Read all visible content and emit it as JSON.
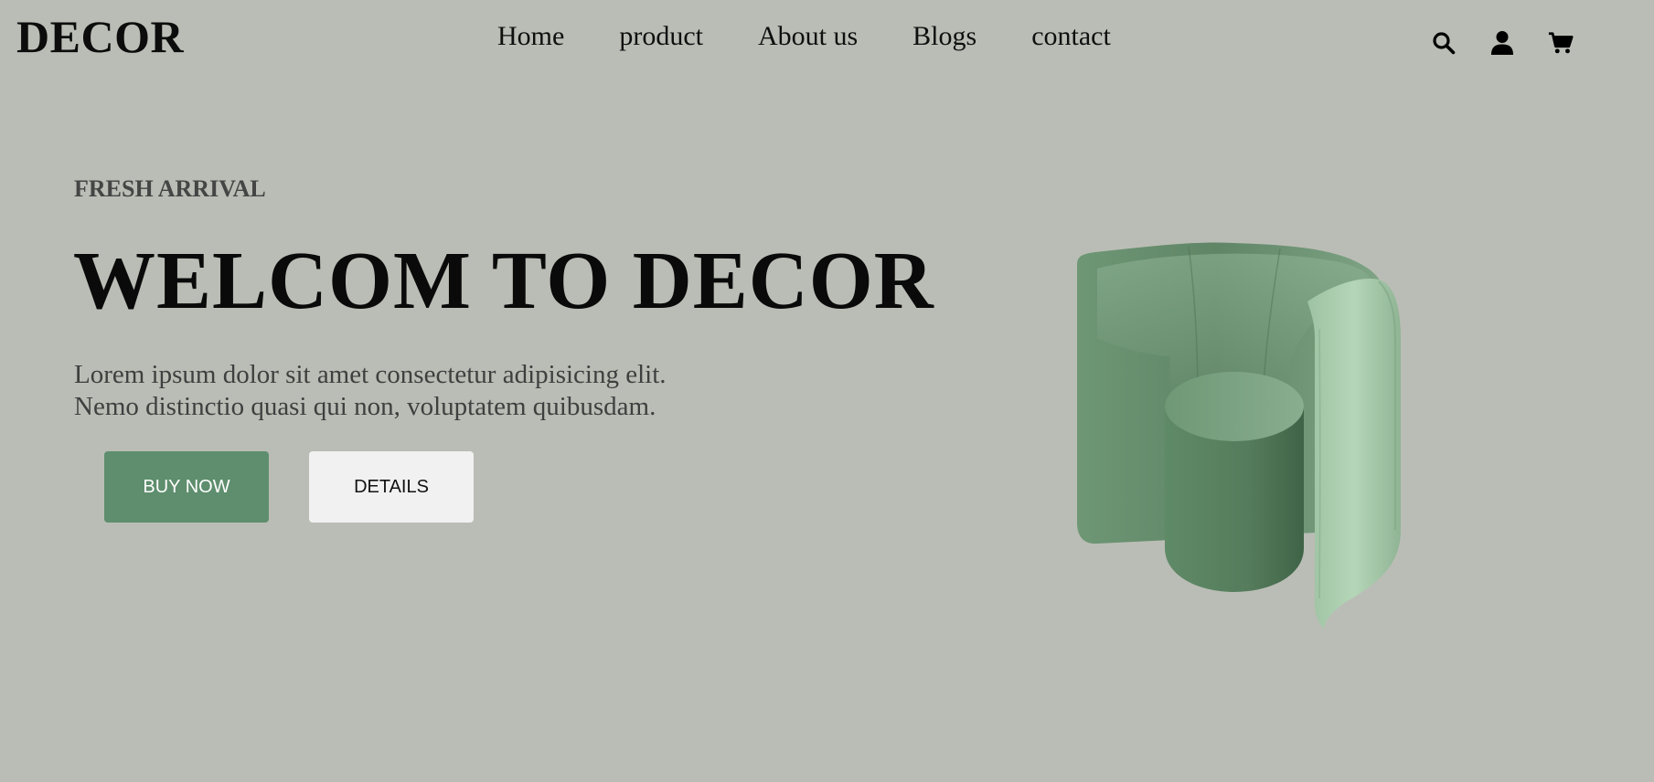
{
  "brand": {
    "logo": "DECOR"
  },
  "nav": {
    "items": [
      {
        "label": "Home"
      },
      {
        "label": "product"
      },
      {
        "label": "About us"
      },
      {
        "label": "Blogs"
      },
      {
        "label": "contact"
      }
    ]
  },
  "header_icons": [
    "search-icon",
    "user-icon",
    "cart-icon"
  ],
  "hero": {
    "eyebrow": "FRESH ARRIVAL",
    "title": "WELCOM TO DECOR",
    "description_lines": [
      "Lorem ipsum dolor sit amet consectetur adipisicing elit.",
      "Nemo distinctio quasi qui non, voluptatem quibusdam."
    ],
    "buy_label": "BUY NOW",
    "details_label": "DETAILS",
    "image": "green-armchair"
  },
  "colors": {
    "background": "#babdb5",
    "buy_button": "#5e8e6d",
    "details_button": "#f1f1f1",
    "chair_green": "#6f9a78"
  }
}
